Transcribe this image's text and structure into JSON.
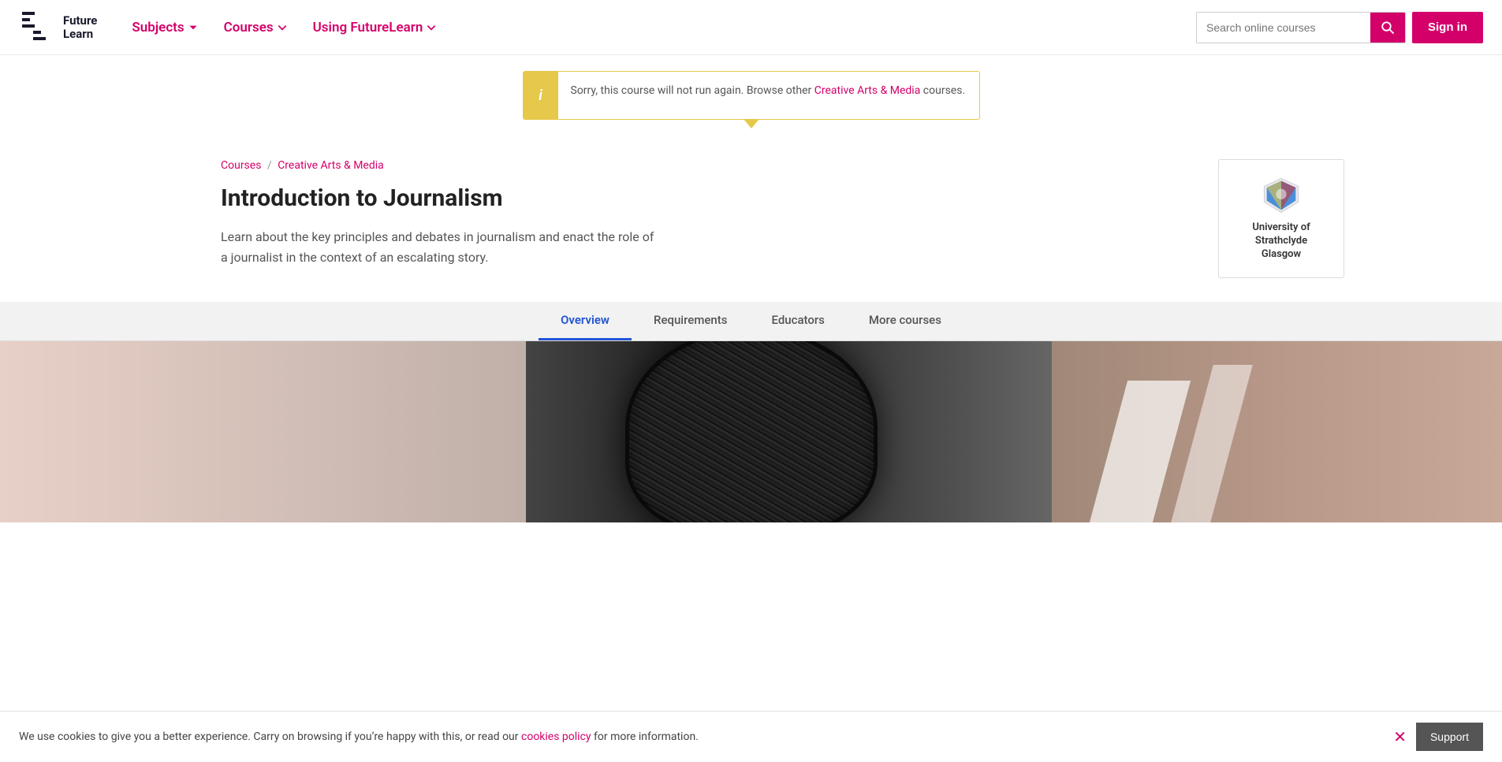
{
  "brand": {
    "name": "FutureLearn",
    "logo_line1": "Future",
    "logo_line2": "Learn"
  },
  "nav": {
    "links": [
      {
        "label": "Subjects",
        "id": "subjects"
      },
      {
        "label": "Courses",
        "id": "courses"
      },
      {
        "label": "Using FutureLearn",
        "id": "using-futurelearn"
      }
    ],
    "search_placeholder": "Search online courses",
    "signin_label": "Sign in"
  },
  "alert": {
    "icon": "i",
    "message_before": "Sorry, this course will not run again. Browse other ",
    "link_text": "Creative Arts & Media",
    "message_after": " courses."
  },
  "breadcrumb": {
    "courses_label": "Courses",
    "separator": "/",
    "category_label": "Creative Arts & Media"
  },
  "course": {
    "title": "Introduction to Journalism",
    "description": "Learn about the key principles and debates in journalism and enact the role of a journalist in the context of an escalating story."
  },
  "university": {
    "name": "University of\nStrathclyde\nGlasgow"
  },
  "tabs": [
    {
      "label": "Overview",
      "active": true,
      "id": "overview"
    },
    {
      "label": "Requirements",
      "active": false,
      "id": "requirements"
    },
    {
      "label": "Educators",
      "active": false,
      "id": "educators"
    },
    {
      "label": "More courses",
      "active": false,
      "id": "more-courses"
    }
  ],
  "cookie": {
    "message_before": "We use cookies to give you a better experience. Carry on browsing if you’re happy with this, or read our ",
    "link_text": "cookies policy",
    "message_after": " for more information.",
    "support_label": "Support"
  }
}
